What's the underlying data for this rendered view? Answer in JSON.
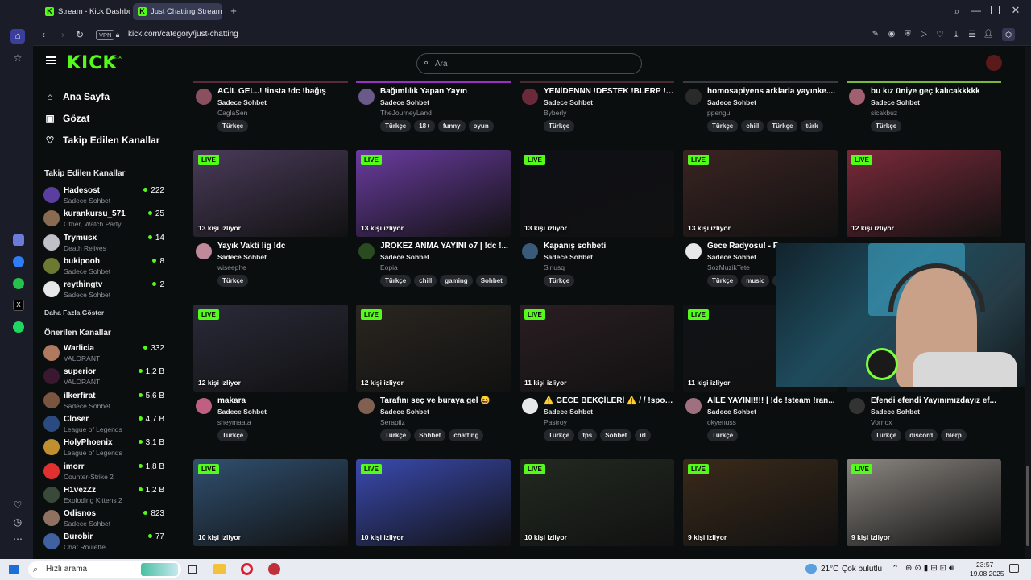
{
  "browser": {
    "tabs": [
      {
        "title": "Stream - Kick Dashboard"
      },
      {
        "title": "Just Chatting Streaming -"
      }
    ],
    "vpn_label": "VPN",
    "url": "kick.com/category/just-chatting"
  },
  "kick": {
    "logo": "KICK",
    "logo_badge": "BETA",
    "search_placeholder": "Ara",
    "nav": [
      {
        "label": "Ana Sayfa",
        "icon": "home-icon"
      },
      {
        "label": "Gözat",
        "icon": "browse-icon"
      },
      {
        "label": "Takip Edilen Kanallar",
        "icon": "heart-icon"
      }
    ],
    "followed_heading": "Takip Edilen Kanallar",
    "followed": [
      {
        "name": "Hadesost",
        "game": "Sadece Sohbet",
        "viewers": "222",
        "color": "#5b3fa0"
      },
      {
        "name": "kurankursu_571",
        "game": "Other, Watch Party",
        "viewers": "25",
        "color": "#8a6a50"
      },
      {
        "name": "Trymusx",
        "game": "Death Relives",
        "viewers": "14",
        "color": "#c0c0c8"
      },
      {
        "name": "bukipooh",
        "game": "Sadece Sohbet",
        "viewers": "8",
        "color": "#6b7a30"
      },
      {
        "name": "reythingtv",
        "game": "Sadece Sohbet",
        "viewers": "2",
        "color": "#e8e8e8"
      }
    ],
    "show_more": "Daha Fazla Göster",
    "recommended_heading": "Önerilen Kanallar",
    "recommended": [
      {
        "name": "Warlicia",
        "game": "VALORANT",
        "viewers": "332",
        "color": "#b07a60"
      },
      {
        "name": "superior",
        "game": "VALORANT",
        "viewers": "1,2 B",
        "color": "#3a1830"
      },
      {
        "name": "ilkerfirat",
        "game": "Sadece Sohbet",
        "viewers": "5,6 B",
        "color": "#7a5540"
      },
      {
        "name": "Closer",
        "game": "League of Legends",
        "viewers": "4,7 B",
        "color": "#2a4a80"
      },
      {
        "name": "HolyPhoenix",
        "game": "League of Legends",
        "viewers": "3,1 B",
        "color": "#c09030"
      },
      {
        "name": "imorr",
        "game": "Counter-Strike 2",
        "viewers": "1,8 B",
        "color": "#e03030"
      },
      {
        "name": "H1vezZz",
        "game": "Exploding Kittens 2",
        "viewers": "1,2 B",
        "color": "#3a4a3a"
      },
      {
        "name": "Odisnos",
        "game": "Sadece Sohbet",
        "viewers": "823",
        "color": "#907060"
      },
      {
        "name": "Burobir",
        "game": "Chat Roulette",
        "viewers": "77",
        "color": "#4060a0"
      }
    ],
    "live_label": "LIVE",
    "row0": [
      {
        "title": "ACİL GEL..! !insta !dc !bağış",
        "category": "Sadece Sohbet",
        "user": "CaglaSen",
        "tags": [
          "Türkçe"
        ]
      },
      {
        "title": "Bağımlılık Yapan Yayın",
        "category": "Sadece Sohbet",
        "user": "TheJourneyLand",
        "tags": [
          "Türkçe",
          "18+",
          "funny",
          "oyun"
        ]
      },
      {
        "title": "YENİDENNN !DESTEK !BLERP !İ...",
        "category": "Sadece Sohbet",
        "user": "Byberly",
        "tags": [
          "Türkçe"
        ]
      },
      {
        "title": "homosapiyens arklarla yayınke....",
        "category": "Sadece Sohbet",
        "user": "ppengu",
        "tags": [
          "Türkçe",
          "chill",
          "Türkçe",
          "türk"
        ]
      },
      {
        "title": "bu kız üniye geç kalıcakkkkk",
        "category": "Sadece Sohbet",
        "user": "sicakbuz",
        "tags": [
          "Türkçe"
        ]
      }
    ],
    "row1": [
      {
        "viewers": "13 kişi izliyor",
        "title": "Yayık Vakti !ig !dc",
        "category": "Sadece Sohbet",
        "user": "wiseephe",
        "tags": [
          "Türkçe"
        ]
      },
      {
        "viewers": "13 kişi izliyor",
        "title": "JROKEZ ANMA YAYINI o7 | !dc !...",
        "category": "Sadece Sohbet",
        "user": "Eopia",
        "tags": [
          "Türkçe",
          "chill",
          "gaming",
          "Sohbet"
        ]
      },
      {
        "viewers": "13 kişi izliyor",
        "title": "Kapanış sohbeti",
        "category": "Sadece Sohbet",
        "user": "Siriusq",
        "tags": [
          "Türkçe"
        ]
      },
      {
        "viewers": "13 kişi izliyor",
        "title": "Gece Radyosu! - R",
        "category": "Sadece Sohbet",
        "user": "SozMuzikTete",
        "tags": [
          "Türkçe",
          "music",
          "S"
        ]
      },
      {
        "viewers": "12 kişi izliyor",
        "title": "",
        "category": "",
        "user": "",
        "tags": []
      }
    ],
    "row2": [
      {
        "viewers": "12 kişi izliyor",
        "title": "makara",
        "category": "Sadece Sohbet",
        "user": "sheymaata",
        "tags": [
          "Türkçe"
        ]
      },
      {
        "viewers": "12 kişi izliyor",
        "title": "Tarafını seç ve buraya gel 😄",
        "category": "Sadece Sohbet",
        "user": "Serapiiz",
        "tags": [
          "Türkçe",
          "Sohbet",
          "chatting"
        ]
      },
      {
        "viewers": "11 kişi izliyor",
        "title": "⚠️ GECE BEKÇİLERİ ⚠️ / / !spoti...",
        "category": "Sadece Sohbet",
        "user": "Pastroy",
        "tags": [
          "Türkçe",
          "fps",
          "Sohbet",
          "ırl"
        ]
      },
      {
        "viewers": "11 kişi izliyor",
        "title": "AİLE YAYINI!!!! | !dc !steam !ran...",
        "category": "Sadece Sohbet",
        "user": "okyenuss",
        "tags": [
          "Türkçe"
        ]
      },
      {
        "viewers": "",
        "title": "Efendi efendi Yayınımızdayız ef...",
        "category": "Sadece Sohbet",
        "user": "Vornox",
        "tags": [
          "Türkçe",
          "discord",
          "blerp"
        ]
      }
    ],
    "row3": [
      {
        "viewers": "10 kişi izliyor"
      },
      {
        "viewers": "10 kişi izliyor"
      },
      {
        "viewers": "10 kişi izliyor"
      },
      {
        "viewers": "9 kişi izliyor"
      },
      {
        "viewers": "9 kişi izliyor"
      }
    ],
    "thumb_colors": [
      [
        "#3a2c3a",
        "#4a1a6a",
        "#2c2222",
        "#3a3a40",
        "#40602a"
      ],
      [
        "#4a3b5a",
        "#6a3ca0",
        "#0e1016",
        "#3a2422",
        "#7a2a3a"
      ],
      [
        "#2a2a3a",
        "#2a2620",
        "#2a1e22",
        "#101216",
        "#1a2a40"
      ],
      [
        "#305070",
        "#3a4ab0",
        "#222a20",
        "#3a2a1a",
        "#8a8680"
      ]
    ]
  },
  "taskbar": {
    "search_placeholder": "Hızlı arama",
    "weather": "21°C",
    "weather_desc": "Çok bulutlu",
    "time": "23:57",
    "date": "19.08.2025"
  }
}
